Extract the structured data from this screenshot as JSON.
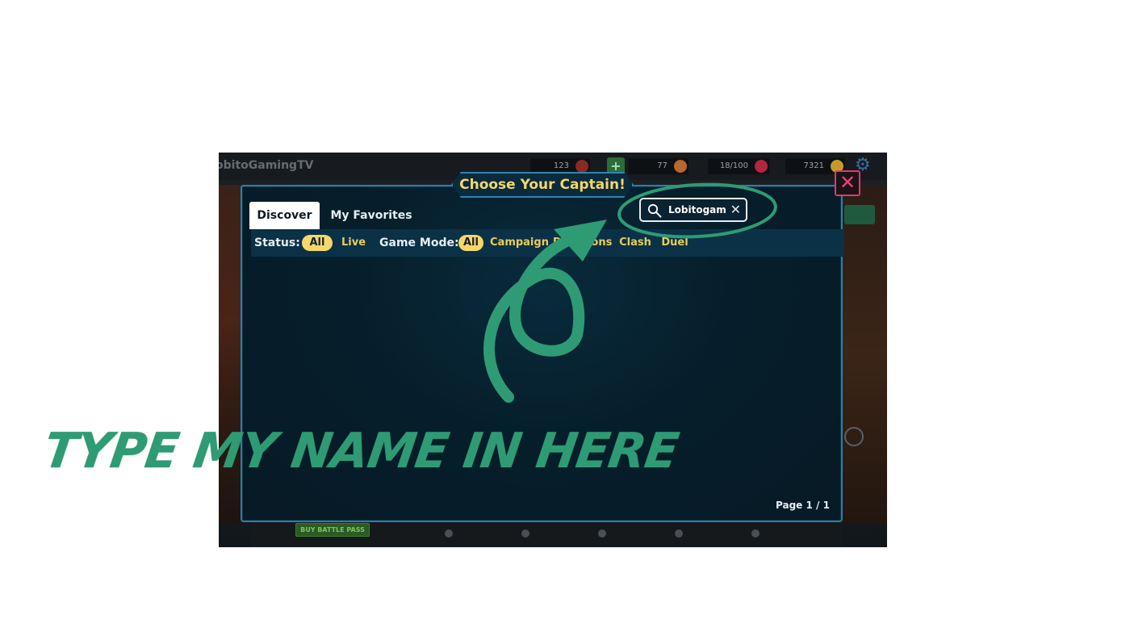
{
  "hud": {
    "username": "obitoGamingTV",
    "stat1": "123",
    "stat2": "77",
    "stat3": "18/100",
    "stat4": "7321",
    "plus_label": "+"
  },
  "dialog": {
    "title": "Choose Your Captain!",
    "close_label": "✕",
    "tabs": [
      {
        "label": "Discover",
        "active": true
      },
      {
        "label": "My Favorites",
        "active": false
      }
    ],
    "status_label": "Status:",
    "status_options": [
      {
        "label": "All",
        "active": true
      },
      {
        "label": "Live",
        "active": false
      }
    ],
    "mode_label": "Game Mode:",
    "mode_options": [
      {
        "label": "All",
        "active": true
      },
      {
        "label": "Campaign",
        "active": false
      },
      {
        "label": "Dungeons",
        "active": false
      },
      {
        "label": "Clash",
        "active": false
      },
      {
        "label": "Duel",
        "active": false
      }
    ],
    "search": {
      "value": "Lobitogam",
      "clear_label": "✕"
    },
    "page_info": "Page 1 / 1"
  },
  "background": {
    "pass_label": "BUY BATTLE PASS"
  },
  "annotation": {
    "text": "TYPE MY NAME IN HERE",
    "color": "#2e9b74"
  }
}
